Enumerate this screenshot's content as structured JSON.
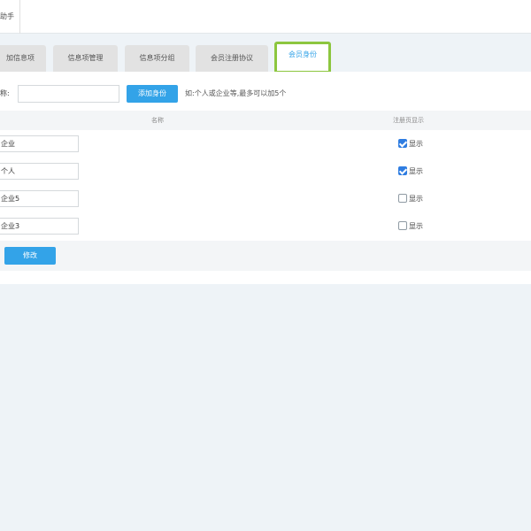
{
  "header": {
    "crumb": "助手"
  },
  "tabs": [
    {
      "label": "加信息项",
      "active": false
    },
    {
      "label": "信息项管理",
      "active": false
    },
    {
      "label": "信息项分组",
      "active": false
    },
    {
      "label": "会员注册协议",
      "active": false
    },
    {
      "label": "会员身份",
      "active": true
    }
  ],
  "add": {
    "label": "称:",
    "input_value": "",
    "button_label": "添加身份",
    "hint": "如:个人或企业等,最多可以加5个"
  },
  "table": {
    "columns": [
      "名称",
      "注册页显示"
    ],
    "rows": [
      {
        "name": "企业",
        "checked": true,
        "label": "显示"
      },
      {
        "name": "个人",
        "checked": true,
        "label": "显示"
      },
      {
        "name": "企业5",
        "checked": false,
        "label": "显示"
      },
      {
        "name": "企业3",
        "checked": false,
        "label": "显示"
      }
    ]
  },
  "footer": {
    "button_label": "修改"
  },
  "colors": {
    "accent": "#33a3e8",
    "active_tab_border": "#8cc63f",
    "background": "#eef3f7"
  }
}
